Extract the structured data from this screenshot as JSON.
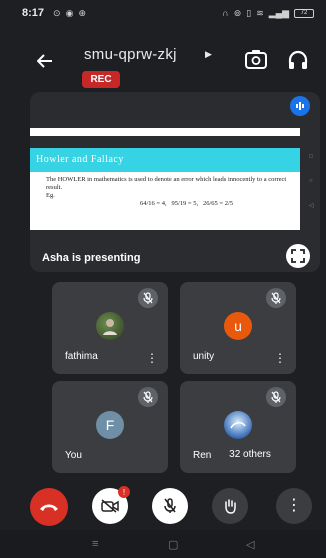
{
  "status_bar": {
    "time": "8:17",
    "battery": "72"
  },
  "header": {
    "meeting_code": "smu-qprw-zkj",
    "rec_badge": "REC"
  },
  "presentation": {
    "presenter_label": "Asha is presenting",
    "slide": {
      "title": "Howler and Fallacy",
      "bullet1": "The HOWLER in mathematics is used to denote an error which leads innocently to a correct result.",
      "bullet2": "Eg.",
      "math1": "64/16 = 4,",
      "math2": "95/19 = 5,",
      "math3": "26/65 = 2/5"
    }
  },
  "tiles": [
    {
      "name": "fathima",
      "avatar_type": "photo"
    },
    {
      "name": "unity",
      "avatar_letter": "u",
      "avatar_color": "#e8590c"
    },
    {
      "name": "You",
      "avatar_letter": "F",
      "avatar_color": "#6f8fa6"
    },
    {
      "name": "Ren",
      "avatar_type": "photo"
    }
  ],
  "others_pill": "32 others",
  "controls": {
    "end_call": "end-call-icon",
    "camera_badge": "!",
    "mic": "mic-off-icon",
    "hand": "raise-hand-icon",
    "more": "more-vert-icon"
  },
  "colors": {
    "end_call": "#d93025",
    "camera_off_bg": "#ffffff",
    "control_bg": "#3c3d41"
  }
}
